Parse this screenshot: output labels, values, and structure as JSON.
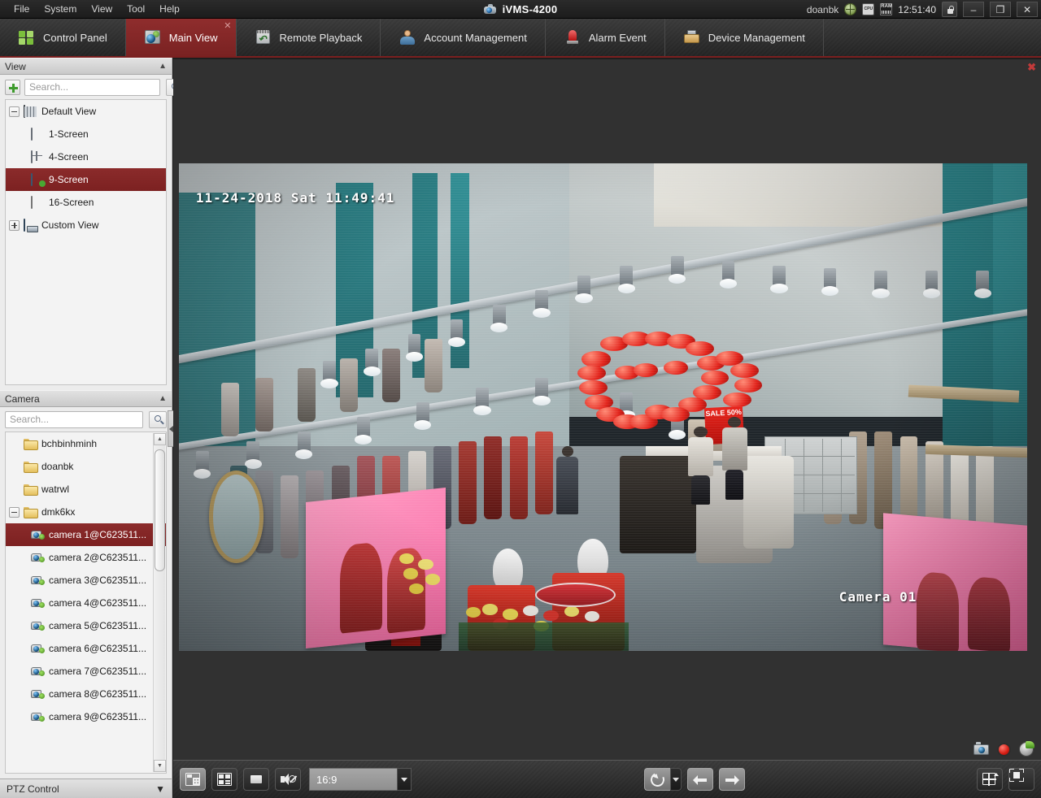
{
  "titlebar": {
    "menus": [
      "File",
      "System",
      "View",
      "Tool",
      "Help"
    ],
    "app_title": "iVMS-4200",
    "user": "doanbk",
    "time": "12:51:40",
    "icons": [
      "globe-icon",
      "cpu-icon",
      "ram-icon",
      "lock-icon"
    ],
    "window_buttons": {
      "minimize": "–",
      "restore": "❐",
      "close": "✕"
    }
  },
  "tabs": [
    {
      "label": "Control Panel",
      "icon": "control-panel-icon",
      "active": false,
      "closable": false
    },
    {
      "label": "Main View",
      "icon": "main-view-icon",
      "active": true,
      "closable": true,
      "close_glyph": "✕"
    },
    {
      "label": "Remote Playback",
      "icon": "remote-playback-icon",
      "active": false,
      "closable": false
    },
    {
      "label": "Account Management",
      "icon": "account-management-icon",
      "active": false,
      "closable": false
    },
    {
      "label": "Alarm Event",
      "icon": "alarm-event-icon",
      "active": false,
      "closable": false
    },
    {
      "label": "Device Management",
      "icon": "device-management-icon",
      "active": false,
      "closable": false
    }
  ],
  "view_panel": {
    "title": "View",
    "collapse_glyph": "▲",
    "search_placeholder": "Search...",
    "search_value": "",
    "add_button_label": "+",
    "tree": [
      {
        "label": "Default View",
        "icon": "table-view-icon",
        "level": 0,
        "expander": "minus",
        "selected": false
      },
      {
        "label": "1-Screen",
        "icon": "screen-1-icon",
        "level": 1,
        "expander": "none",
        "selected": false
      },
      {
        "label": "4-Screen",
        "icon": "screen-4-icon",
        "level": 1,
        "expander": "none",
        "selected": false
      },
      {
        "label": "9-Screen",
        "icon": "screen-9-icon",
        "level": 1,
        "expander": "none",
        "selected": true
      },
      {
        "label": "16-Screen",
        "icon": "screen-16-icon",
        "level": 1,
        "expander": "none",
        "selected": false
      },
      {
        "label": "Custom View",
        "icon": "custom-view-icon",
        "level": 0,
        "expander": "plus",
        "selected": false
      }
    ]
  },
  "camera_panel": {
    "title": "Camera",
    "collapse_glyph": "▲",
    "search_placeholder": "Search...",
    "search_value": "",
    "tree": [
      {
        "label": "bchbinhminh",
        "icon": "folder-icon",
        "level": 0,
        "expander": "none",
        "selected": false
      },
      {
        "label": "doanbk",
        "icon": "folder-icon",
        "level": 0,
        "expander": "none",
        "selected": false
      },
      {
        "label": "watrwl",
        "icon": "folder-icon",
        "level": 0,
        "expander": "none",
        "selected": false
      },
      {
        "label": "dmk6kx",
        "icon": "folder-icon",
        "level": 0,
        "expander": "minus",
        "selected": false
      },
      {
        "label": "camera 1@C623511...",
        "icon": "camera-icon",
        "level": 1,
        "expander": "none",
        "selected": true
      },
      {
        "label": "camera 2@C623511...",
        "icon": "camera-icon",
        "level": 1,
        "expander": "none",
        "selected": false
      },
      {
        "label": "camera 3@C623511...",
        "icon": "camera-icon",
        "level": 1,
        "expander": "none",
        "selected": false
      },
      {
        "label": "camera 4@C623511...",
        "icon": "camera-icon",
        "level": 1,
        "expander": "none",
        "selected": false
      },
      {
        "label": "camera 5@C623511...",
        "icon": "camera-icon",
        "level": 1,
        "expander": "none",
        "selected": false
      },
      {
        "label": "camera 6@C623511...",
        "icon": "camera-icon",
        "level": 1,
        "expander": "none",
        "selected": false
      },
      {
        "label": "camera 7@C623511...",
        "icon": "camera-icon",
        "level": 1,
        "expander": "none",
        "selected": false
      },
      {
        "label": "camera 8@C623511...",
        "icon": "camera-icon",
        "level": 1,
        "expander": "none",
        "selected": false
      },
      {
        "label": "camera 9@C623511...",
        "icon": "camera-icon",
        "level": 1,
        "expander": "none",
        "selected": false
      }
    ],
    "scroll_up_glyph": "▲",
    "scroll_down_glyph": "▼"
  },
  "ptz_panel": {
    "title": "PTZ Control",
    "expand_glyph": "▼"
  },
  "sidebar_collapse": {
    "name": "collapse-sidebar-handle"
  },
  "video": {
    "close_glyph": "✖",
    "osd_timestamp": "11-24-2018 Sat 11:49:41",
    "osd_camera_name": "Camera 01",
    "sale_sign": "SALE 50%",
    "overlay_icons": [
      "capture-snapshot-icon",
      "record-icon",
      "instant-playback-icon"
    ]
  },
  "bottom_toolbar": {
    "buttons": [
      {
        "name": "screen-layout-button",
        "icon": "window-layout-icon",
        "active": true
      },
      {
        "name": "multi-window-button",
        "icon": "multi-window-icon",
        "active": false
      },
      {
        "name": "stop-all-live-view-button",
        "icon": "stop-icon",
        "active": false
      },
      {
        "name": "mute-audio-button",
        "icon": "mute-speaker-icon",
        "active": false
      }
    ],
    "aspect_ratio": {
      "value": "16:9",
      "dropdown_glyph": "▼"
    },
    "cycle_button": {
      "name": "auto-switch-button",
      "icon": "cycle-icon",
      "dropdown_glyph": "▼"
    },
    "prev_button": {
      "name": "previous-page-button",
      "icon": "arrow-left-icon"
    },
    "next_button": {
      "name": "next-page-button",
      "icon": "arrow-right-icon"
    },
    "layout_button": {
      "name": "window-division-button",
      "icon": "grid-layout-icon"
    },
    "fullscreen_button": {
      "name": "full-screen-button",
      "icon": "fullscreen-icon"
    }
  },
  "colors": {
    "accent_red": "#7a2222",
    "tab_active": "#8f2d2d",
    "selection_red": "#8b2b2b",
    "chrome_dark": "#2b2b2b",
    "panel_light": "#ececec"
  }
}
